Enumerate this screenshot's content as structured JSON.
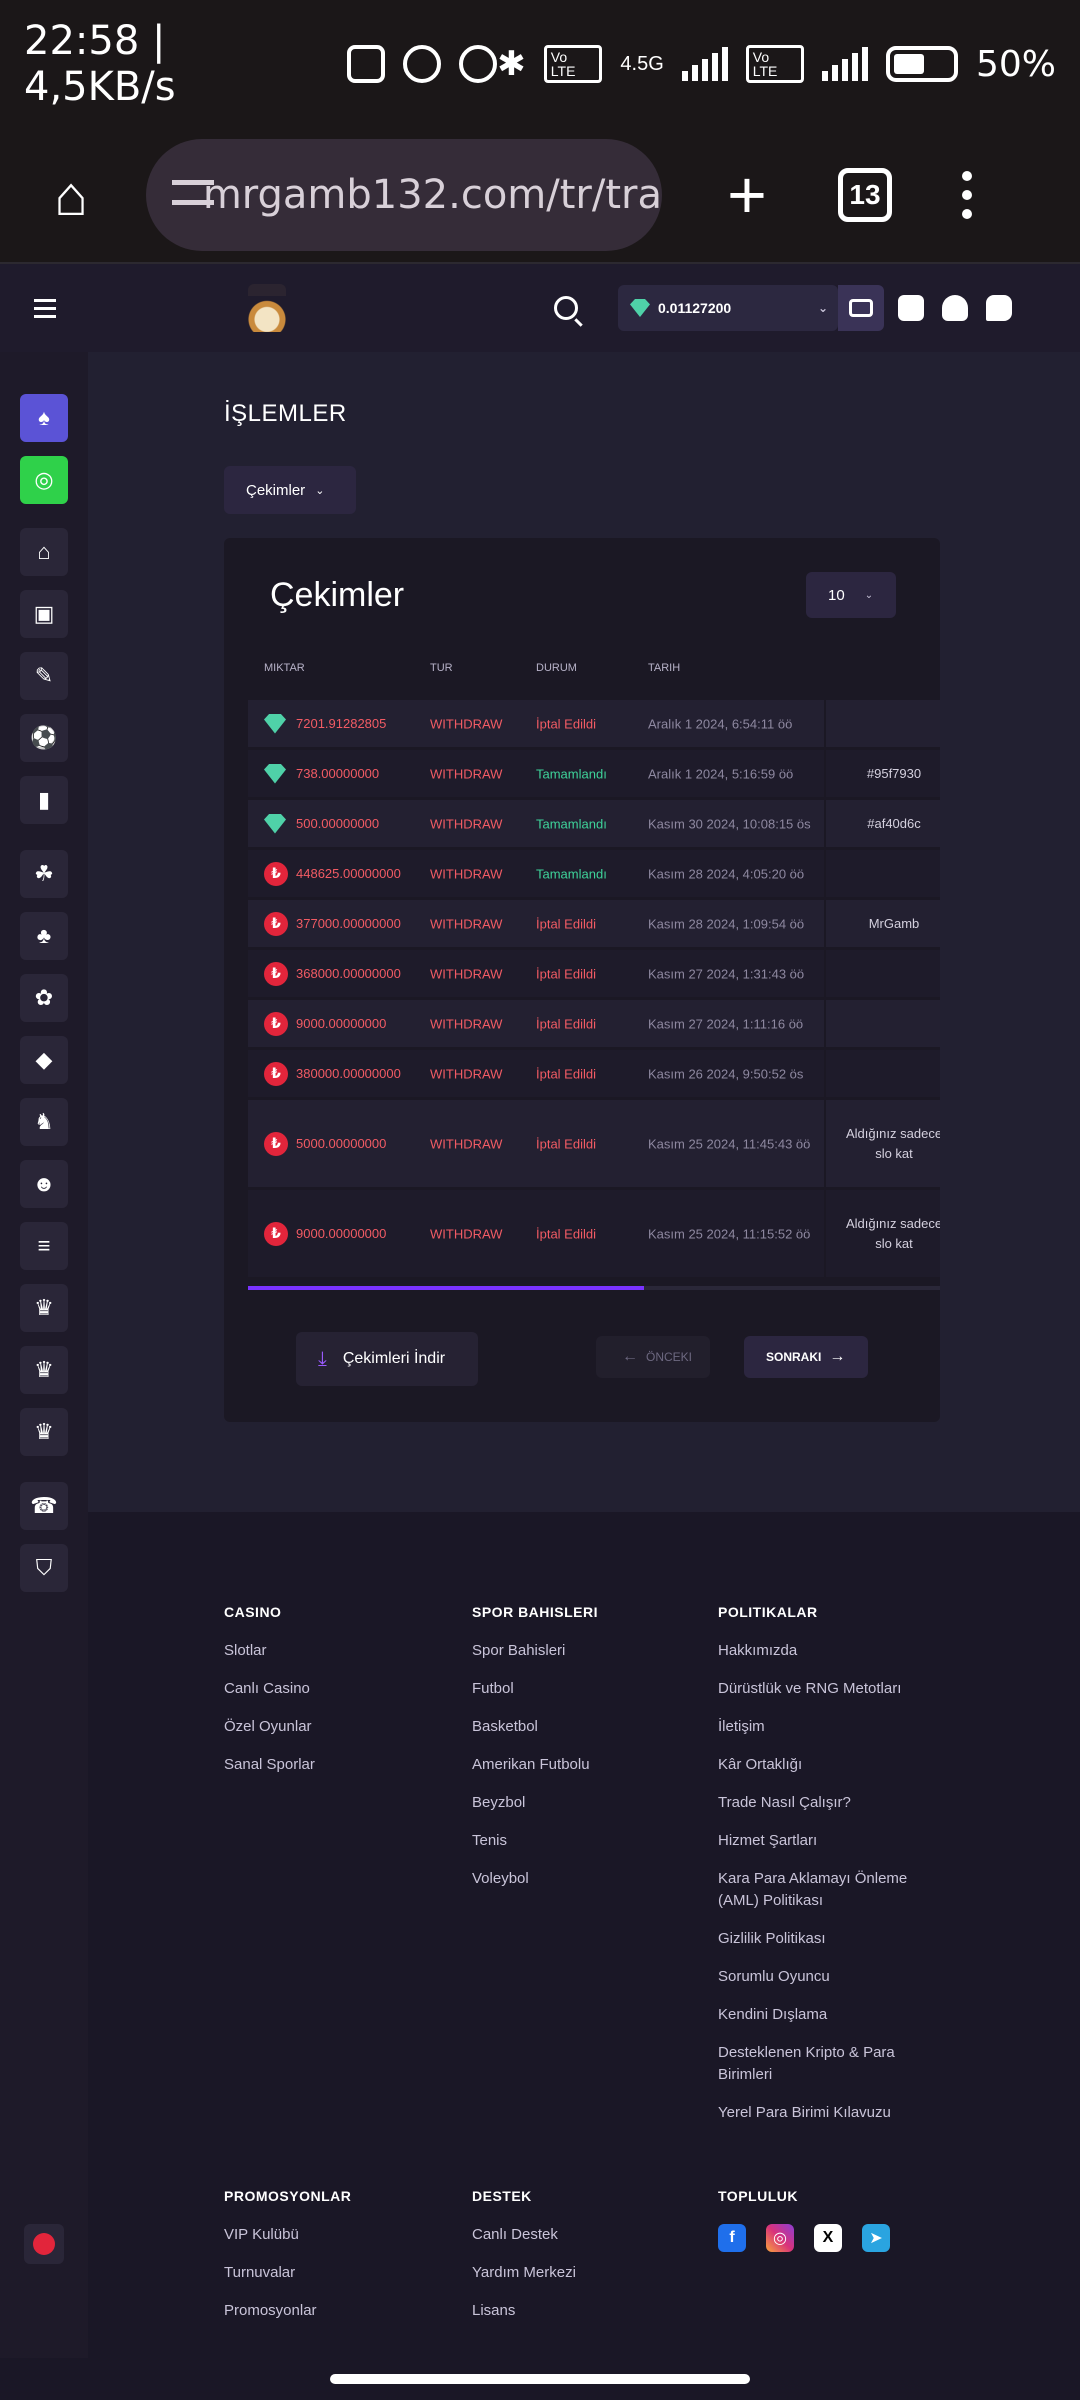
{
  "status_bar": {
    "time": "22:58 | 4,5KB/s",
    "network": "4.5G",
    "volte": "Vo LTE",
    "battery": "50%"
  },
  "browser": {
    "url": "mrgamb132.com/tr/tra",
    "tab_count": "13"
  },
  "header": {
    "balance": "0.01127200"
  },
  "page": {
    "title": "İŞLEMLER",
    "filter_label": "Çekimler"
  },
  "card": {
    "title": "Çekimler",
    "rows_per_page": "10",
    "columns": [
      "MIKTAR",
      "TUR",
      "DURUM",
      "TARIH"
    ],
    "rows": [
      {
        "coin": "usdt",
        "amount": "7201.91282805",
        "type": "WITHDRAW",
        "status": "İptal Edildi",
        "date": "Aralık 1 2024, 6:54:11 öö",
        "extra": ""
      },
      {
        "coin": "usdt",
        "amount": "738.00000000",
        "type": "WITHDRAW",
        "status": "Tamamlandı",
        "date": "Aralık 1 2024, 5:16:59 öö",
        "extra": "#95f7930"
      },
      {
        "coin": "usdt",
        "amount": "500.00000000",
        "type": "WITHDRAW",
        "status": "Tamamlandı",
        "date": "Kasım 30 2024, 10:08:15 ös",
        "extra": "#af40d6c"
      },
      {
        "coin": "try",
        "amount": "448625.00000000",
        "type": "WITHDRAW",
        "status": "Tamamlandı",
        "date": "Kasım 28 2024, 4:05:20 öö",
        "extra": ""
      },
      {
        "coin": "try",
        "amount": "377000.00000000",
        "type": "WITHDRAW",
        "status": "İptal Edildi",
        "date": "Kasım 28 2024, 1:09:54 öö",
        "extra": "MrGamb"
      },
      {
        "coin": "try",
        "amount": "368000.00000000",
        "type": "WITHDRAW",
        "status": "İptal Edildi",
        "date": "Kasım 27 2024, 1:31:43 öö",
        "extra": ""
      },
      {
        "coin": "try",
        "amount": "9000.00000000",
        "type": "WITHDRAW",
        "status": "İptal Edildi",
        "date": "Kasım 27 2024, 1:11:16 öö",
        "extra": ""
      },
      {
        "coin": "try",
        "amount": "380000.00000000",
        "type": "WITHDRAW",
        "status": "İptal Edildi",
        "date": "Kasım 26 2024, 9:50:52 ös",
        "extra": ""
      },
      {
        "coin": "try",
        "amount": "5000.00000000",
        "type": "WITHDRAW",
        "status": "İptal Edildi",
        "date": "Kasım 25 2024, 11:45:43 öö",
        "extra": "Aldığınız sadece slo kat"
      },
      {
        "coin": "try",
        "amount": "9000.00000000",
        "type": "WITHDRAW",
        "status": "İptal Edildi",
        "date": "Kasım 25 2024, 11:15:52 öö",
        "extra": "Aldığınız sadece slo kat"
      }
    ],
    "download_label": "Çekimleri İndir",
    "prev_label": "ÖNCEKI",
    "next_label": "SONRAKI"
  },
  "footer": {
    "casino": {
      "title": "CASINO",
      "links": [
        "Slotlar",
        "Canlı Casino",
        "Özel Oyunlar",
        "Sanal Sporlar"
      ]
    },
    "sports": {
      "title": "SPOR BAHISLERI",
      "links": [
        "Spor Bahisleri",
        "Futbol",
        "Basketbol",
        "Amerikan Futbolu",
        "Beyzbol",
        "Tenis",
        "Voleybol"
      ]
    },
    "policies": {
      "title": "POLITIKALAR",
      "links": [
        "Hakkımızda",
        "Dürüstlük ve RNG Metotları",
        "İletişim",
        "Kâr Ortaklığı",
        "Trade Nasıl Çalışır?",
        "Hizmet Şartları",
        "Kara Para Aklamayı Önleme (AML) Politikası",
        "Gizlilik Politikası",
        "Sorumlu Oyuncu",
        "Kendini Dışlama",
        "Desteklenen Kripto & Para Birimleri",
        "Yerel Para Birimi Kılavuzu"
      ]
    },
    "promos": {
      "title": "PROMOSYONLAR",
      "links": [
        "VIP Kulübü",
        "Turnuvalar",
        "Promosyonlar"
      ]
    },
    "support": {
      "title": "DESTEK",
      "links": [
        "Canlı Destek",
        "Yardım Merkezi",
        "Lisans"
      ]
    },
    "community": {
      "title": "TOPLULUK"
    }
  },
  "colors": {
    "accent": "#7a33ff",
    "cancelled": "#f25b64",
    "completed": "#3ed39a"
  }
}
